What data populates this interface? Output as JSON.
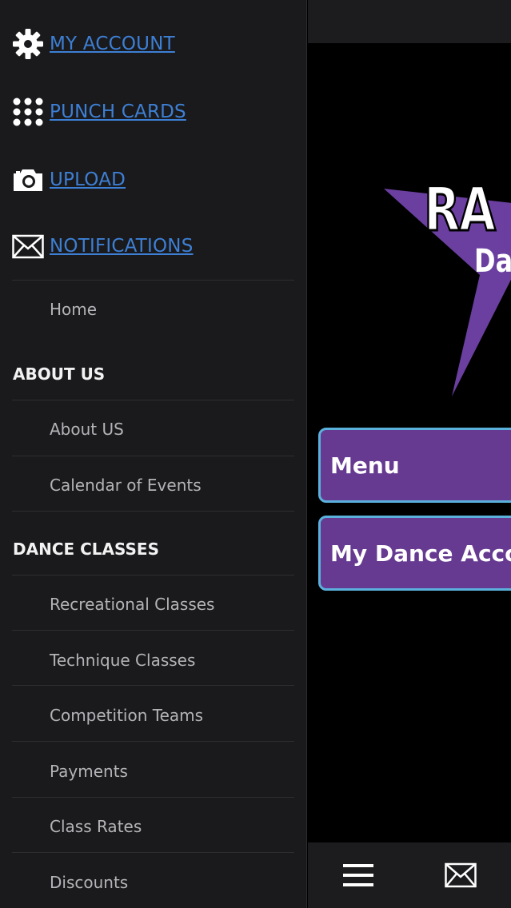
{
  "drawer": {
    "top_links": [
      {
        "label": "MY ACCOUNT",
        "icon": "gear-icon"
      },
      {
        "label": "PUNCH CARDS",
        "icon": "grid-dots-icon"
      },
      {
        "label": "UPLOAD",
        "icon": "camera-icon"
      },
      {
        "label": "NOTIFICATIONS",
        "icon": "envelope-icon"
      }
    ],
    "home": "Home",
    "sections": [
      {
        "title": "ABOUT US",
        "items": [
          "About US",
          "Calendar of Events"
        ]
      },
      {
        "title": "DANCE CLASSES",
        "items": [
          "Recreational Classes",
          "Technique Classes",
          "Competition Teams",
          "Payments",
          "Class Rates",
          "Discounts"
        ]
      }
    ]
  },
  "logo": {
    "line1": "RA",
    "line2": "Da"
  },
  "main": {
    "buttons": [
      "Menu",
      "My Dance Account"
    ]
  },
  "bottom_bar": {
    "icons": [
      "hamburger-menu-icon",
      "envelope-icon"
    ]
  },
  "colors": {
    "link": "#3d7fd4",
    "button_fill": "#663a91",
    "button_border": "#5ab2dc",
    "star": "#6a3fa0",
    "drawer_bg": "#1a1a1c"
  }
}
